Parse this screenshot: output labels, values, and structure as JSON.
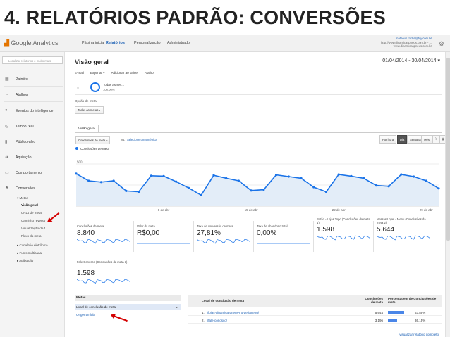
{
  "slide_title": "4. RELATÓRIOS PADRÃO: CONVERSÕES",
  "topbar": {
    "logo_prefix": "Google",
    "logo_name": "Analytics",
    "nav": [
      "Página inicial",
      "Relatórios",
      "Personalização",
      "Administrador"
    ],
    "active_nav": "Relatórios",
    "account_email": "matheus.rocha@fcy.com.br",
    "account_url1": "http://www.dinamicaspneus.com.br - ...",
    "account_url2": "www.dinamicaspneus.com.br"
  },
  "sidebar": {
    "search_placeholder": "Localizar relatórios e muito mais",
    "items": [
      {
        "icon": "grid-icon",
        "glyph": "▦",
        "label": "Painéis"
      },
      {
        "icon": "shortcut-icon",
        "glyph": "↔",
        "label": "Atalhos"
      },
      {
        "icon": "lightbulb-icon",
        "glyph": "●",
        "label": "Eventos do intelligence"
      },
      {
        "icon": "clock-icon",
        "glyph": "◷",
        "label": "Tempo real"
      },
      {
        "icon": "people-icon",
        "glyph": "▮",
        "label": "Público-alvo"
      },
      {
        "icon": "acquisition-icon",
        "glyph": "➜",
        "label": "Aquisição"
      },
      {
        "icon": "behavior-icon",
        "glyph": "▭",
        "label": "Comportamento"
      },
      {
        "icon": "flag-icon",
        "glyph": "⚑",
        "label": "Conversões"
      }
    ],
    "metas_label": "▾ Metas",
    "metas_sub": [
      "Visão geral",
      "URLs de meta",
      "Caminho reverso",
      "Visualização de f...",
      "Fluxo da meta"
    ],
    "other_sub": [
      "▸ Comércio eletrônico",
      "▸ Funis multicanal",
      "▸ Atribuição"
    ]
  },
  "main": {
    "page_title": "Visão geral",
    "date_range": "01/04/2014 - 30/04/2014 ▾",
    "toolbar": [
      "E-mail",
      "Exportar ▾",
      "Adicionar ao painel",
      "Atalho"
    ],
    "segment_label": "Todas as ses...",
    "segment_pct": "100,00%",
    "goal_option_label": "Opção de meta:",
    "goal_option_value": "Todas as metas ▾",
    "tab_label": "Visão geral",
    "metric_select": "Conclusões de meta ▾",
    "vs_label": "vs.",
    "select_metric": "Selecione uma métrica",
    "granularity": [
      "Por hora",
      "Dia",
      "Semana",
      "Mês"
    ],
    "active_granularity": "Dia",
    "legend": "Conclusões de meta"
  },
  "chart_data": {
    "type": "line",
    "series": [
      {
        "name": "Conclusões de meta",
        "values": [
          385,
          300,
          285,
          300,
          180,
          170,
          360,
          355,
          290,
          215,
          130,
          365,
          330,
          300,
          185,
          195,
          370,
          350,
          330,
          225,
          170,
          375,
          355,
          330,
          245,
          235,
          375,
          350,
          300,
          210
        ]
      }
    ],
    "y_ticks": [
      "500",
      "250"
    ],
    "ylim": [
      0,
      600
    ],
    "x_tick_labels": [
      "8 de abr",
      "15 de abr",
      "22 de abr",
      "29 de abr"
    ],
    "x_tick_days": [
      8,
      15,
      22,
      29
    ],
    "x_days": [
      1,
      30
    ],
    "grid": true,
    "color": "#1a73e8"
  },
  "scorecards": [
    {
      "label": "Conclusões de meta",
      "value": "8.840"
    },
    {
      "label": "Valor da meta",
      "value": "R$0,00"
    },
    {
      "label": "Taxa de conversão de meta",
      "value": "27,81%"
    },
    {
      "label": "Taxa de abandono total",
      "value": "0,00%"
    },
    {
      "label": "Botão - Lojas Topo (Conclusões da meta 1)",
      "value": "1.598"
    },
    {
      "label": "Nossas Lojas - Menu (Conclusões da meta 2)",
      "value": "5.644"
    },
    {
      "label": "Fale Conosco (Conclusões da meta 3)",
      "value": "1.598"
    }
  ],
  "bottom": {
    "left_header": "Metas",
    "left_selected": "Local de conclusão de meta",
    "left_link": "Origem/mídia",
    "table_headers": [
      "Local de conclusão de meta",
      "Conclusões de meta",
      "Porcentagem de Conclusões de meta"
    ],
    "rows": [
      {
        "index": "1.",
        "path": "/lojas-dinamica-pneus-rio-de-janeiro/",
        "count": "5.644",
        "pct": "63,85%",
        "pct_value": 63.85
      },
      {
        "index": "2.",
        "path": "/fale-conosco/",
        "count": "3.196",
        "pct": "36,15%",
        "pct_value": 36.15
      }
    ],
    "full_report_link": "visualizar relatório completo"
  }
}
